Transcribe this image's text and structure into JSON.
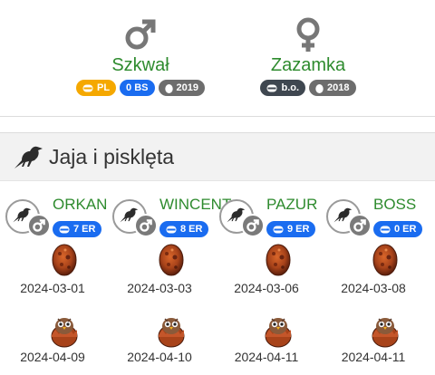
{
  "parents": {
    "male": {
      "sex_icon": "male-symbol-icon",
      "name": "Szkwał",
      "badges": [
        {
          "icon": "ring-icon",
          "label": "PL",
          "color": "#f5a800"
        },
        {
          "icon": "ring-icon",
          "label": "0 BS",
          "color": "#1a6cf0"
        },
        {
          "icon": "egg-icon",
          "label": "2019",
          "color": "#6d6d6d"
        }
      ]
    },
    "female": {
      "sex_icon": "female-symbol-icon",
      "name": "Zazamka",
      "badges": [
        {
          "icon": "ring-icon",
          "label": "b.o.",
          "color": "#3f4750"
        },
        {
          "icon": "egg-icon",
          "label": "2018",
          "color": "#6d6d6d"
        }
      ]
    }
  },
  "section": {
    "icon": "crow-icon",
    "title": "Jaja i pisklęta"
  },
  "chicks": [
    {
      "name": "ORKAN",
      "er": "7 ER",
      "egg_date": "2024-03-01",
      "hatch_date": "2024-04-09"
    },
    {
      "name": "WINCENT",
      "er": "8 ER",
      "egg_date": "2024-03-03",
      "hatch_date": "2024-04-10"
    },
    {
      "name": "PAZUR",
      "er": "9 ER",
      "egg_date": "2024-03-06",
      "hatch_date": "2024-04-11"
    },
    {
      "name": "BOSS",
      "er": "0 ER",
      "egg_date": "2024-03-08",
      "hatch_date": "2024-04-11"
    }
  ],
  "colors": {
    "name_green": "#2e8b2e",
    "badge_blue": "#1a6cf0",
    "badge_yellow": "#f5a800",
    "badge_gray": "#6d6d6d"
  }
}
